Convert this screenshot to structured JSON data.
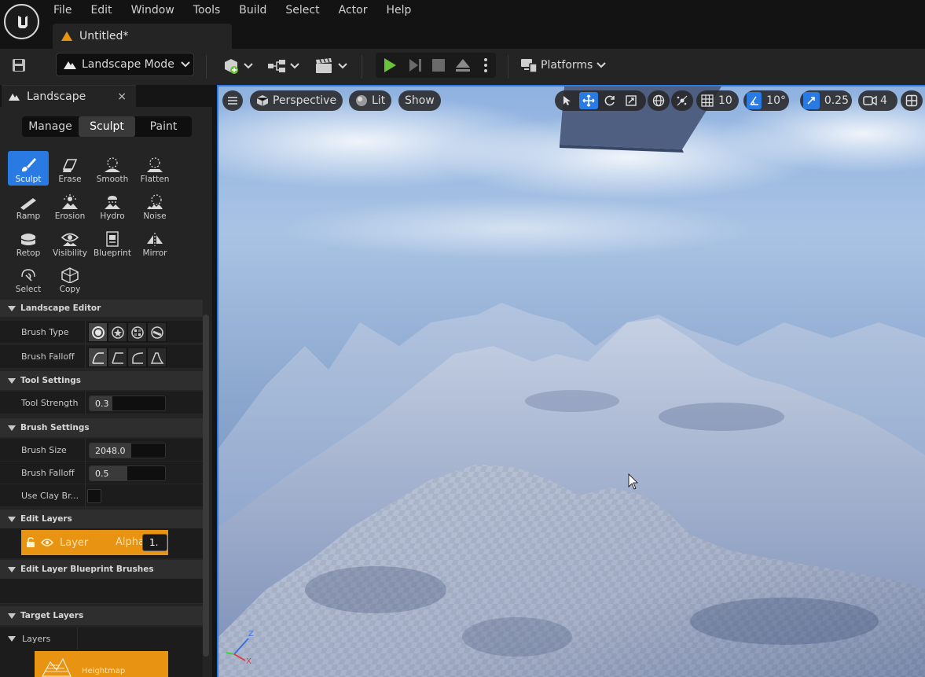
{
  "menu": {
    "items": [
      "File",
      "Edit",
      "Window",
      "Tools",
      "Build",
      "Select",
      "Actor",
      "Help"
    ]
  },
  "document_tab": {
    "label": "Untitled*"
  },
  "toolbar": {
    "mode_label": "Landscape Mode",
    "platforms_label": "Platforms"
  },
  "panel": {
    "tab_label": "Landscape",
    "close_glyph": "×",
    "modes": [
      "Manage",
      "Sculpt",
      "Paint"
    ],
    "active_mode": "Sculpt",
    "tools": [
      {
        "label": "Sculpt",
        "icon": "brush-icon"
      },
      {
        "label": "Erase",
        "icon": "eraser-icon"
      },
      {
        "label": "Smooth",
        "icon": "smooth-icon"
      },
      {
        "label": "Flatten",
        "icon": "flatten-icon"
      },
      {
        "label": "Ramp",
        "icon": "ramp-icon"
      },
      {
        "label": "Erosion",
        "icon": "erosion-icon"
      },
      {
        "label": "Hydro",
        "icon": "hydro-icon"
      },
      {
        "label": "Noise",
        "icon": "noise-icon"
      },
      {
        "label": "Retop",
        "icon": "retop-icon"
      },
      {
        "label": "Visibility",
        "icon": "visibility-icon"
      },
      {
        "label": "Blueprint",
        "icon": "blueprint-icon"
      },
      {
        "label": "Mirror",
        "icon": "mirror-icon"
      },
      {
        "label": "Select",
        "icon": "select-icon"
      },
      {
        "label": "Copy",
        "icon": "copy-icon"
      }
    ],
    "active_tool": "Sculpt",
    "sections": {
      "landscape_editor": "Landscape Editor",
      "tool_settings": "Tool Settings",
      "brush_settings": "Brush Settings",
      "edit_layers": "Edit Layers",
      "edit_layer_bp": "Edit Layer Blueprint Brushes",
      "target_layers": "Target Layers",
      "layers": "Layers"
    },
    "props": {
      "brush_type": "Brush Type",
      "brush_falloff_type": "Brush Falloff",
      "tool_strength": {
        "label": "Tool Strength",
        "value": "0.3",
        "fraction": 0.3
      },
      "brush_size": {
        "label": "Brush Size",
        "value": "2048.0",
        "fraction": 0.55
      },
      "brush_falloff": {
        "label": "Brush Falloff",
        "value": "0.5",
        "fraction": 0.5
      },
      "use_clay": {
        "label": "Use Clay Br...",
        "checked": false
      }
    },
    "layer": {
      "name": "Layer",
      "alpha_label": "Alpha",
      "alpha_value": "1."
    },
    "heightmap_label": "Heightmap"
  },
  "viewport": {
    "perspective": "Perspective",
    "lit": "Lit",
    "show": "Show",
    "grid_snap": "10",
    "rot_snap": "10°",
    "scale_snap": "0.25",
    "camera_speed": "4"
  },
  "colors": {
    "accent_blue": "#2a7ae4",
    "layer_orange": "#e89311",
    "play_green": "#6ac43a"
  }
}
